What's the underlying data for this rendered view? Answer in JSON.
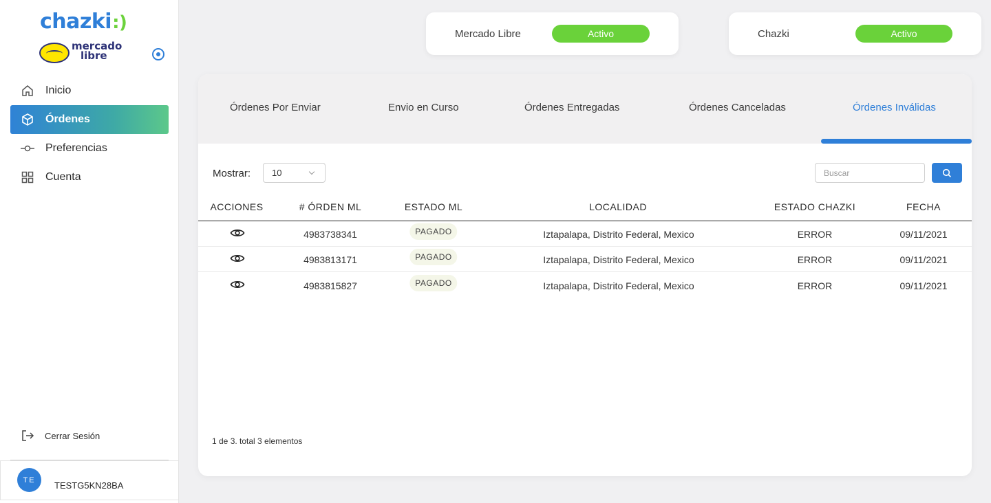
{
  "brand": {
    "logo": "chazki",
    "partner_logo_line1": "mercado",
    "partner_logo_line2": "libre"
  },
  "sidebar": {
    "items": [
      {
        "label": "Inicio",
        "icon": "home-icon"
      },
      {
        "label": "Órdenes",
        "icon": "box-icon",
        "active": true
      },
      {
        "label": "Preferencias",
        "icon": "commit-icon"
      },
      {
        "label": "Cuenta",
        "icon": "grid-icon"
      }
    ],
    "logout_label": "Cerrar Sesión",
    "user": {
      "initials": "TE",
      "name": "TESTG5KN28BA"
    }
  },
  "status_cards": [
    {
      "name": "Mercado Libre",
      "status": "Activo"
    },
    {
      "name": "Chazki",
      "status": "Activo"
    }
  ],
  "tabs": [
    {
      "label": "Órdenes Por Enviar"
    },
    {
      "label": "Envio en Curso"
    },
    {
      "label": "Órdenes Entregadas"
    },
    {
      "label": "Órdenes Canceladas"
    },
    {
      "label": "Órdenes Inválidas",
      "active": true
    }
  ],
  "controls": {
    "show_label": "Mostrar:",
    "show_value": "10",
    "search_placeholder": "Buscar"
  },
  "table": {
    "columns": [
      "ACCIONES",
      "# ÓRDEN ML",
      "ESTADO ML",
      "LOCALIDAD",
      "ESTADO CHAZKI",
      "FECHA"
    ],
    "rows": [
      {
        "order": "4983738341",
        "estado_ml": "PAGADO",
        "localidad": "Iztapalapa, Distrito Federal, Mexico",
        "estado_chazki": "ERROR",
        "fecha": "09/11/2021"
      },
      {
        "order": "4983813171",
        "estado_ml": "PAGADO",
        "localidad": "Iztapalapa, Distrito Federal, Mexico",
        "estado_chazki": "ERROR",
        "fecha": "09/11/2021"
      },
      {
        "order": "4983815827",
        "estado_ml": "PAGADO",
        "localidad": "Iztapalapa, Distrito Federal, Mexico",
        "estado_chazki": "ERROR",
        "fecha": "09/11/2021"
      }
    ]
  },
  "pagination_text": "1 de 3. total 3 elementos",
  "colors": {
    "accent": "#2f7fd8",
    "active_status": "#6ad23a",
    "badge_bg": "#f4f6e8"
  }
}
